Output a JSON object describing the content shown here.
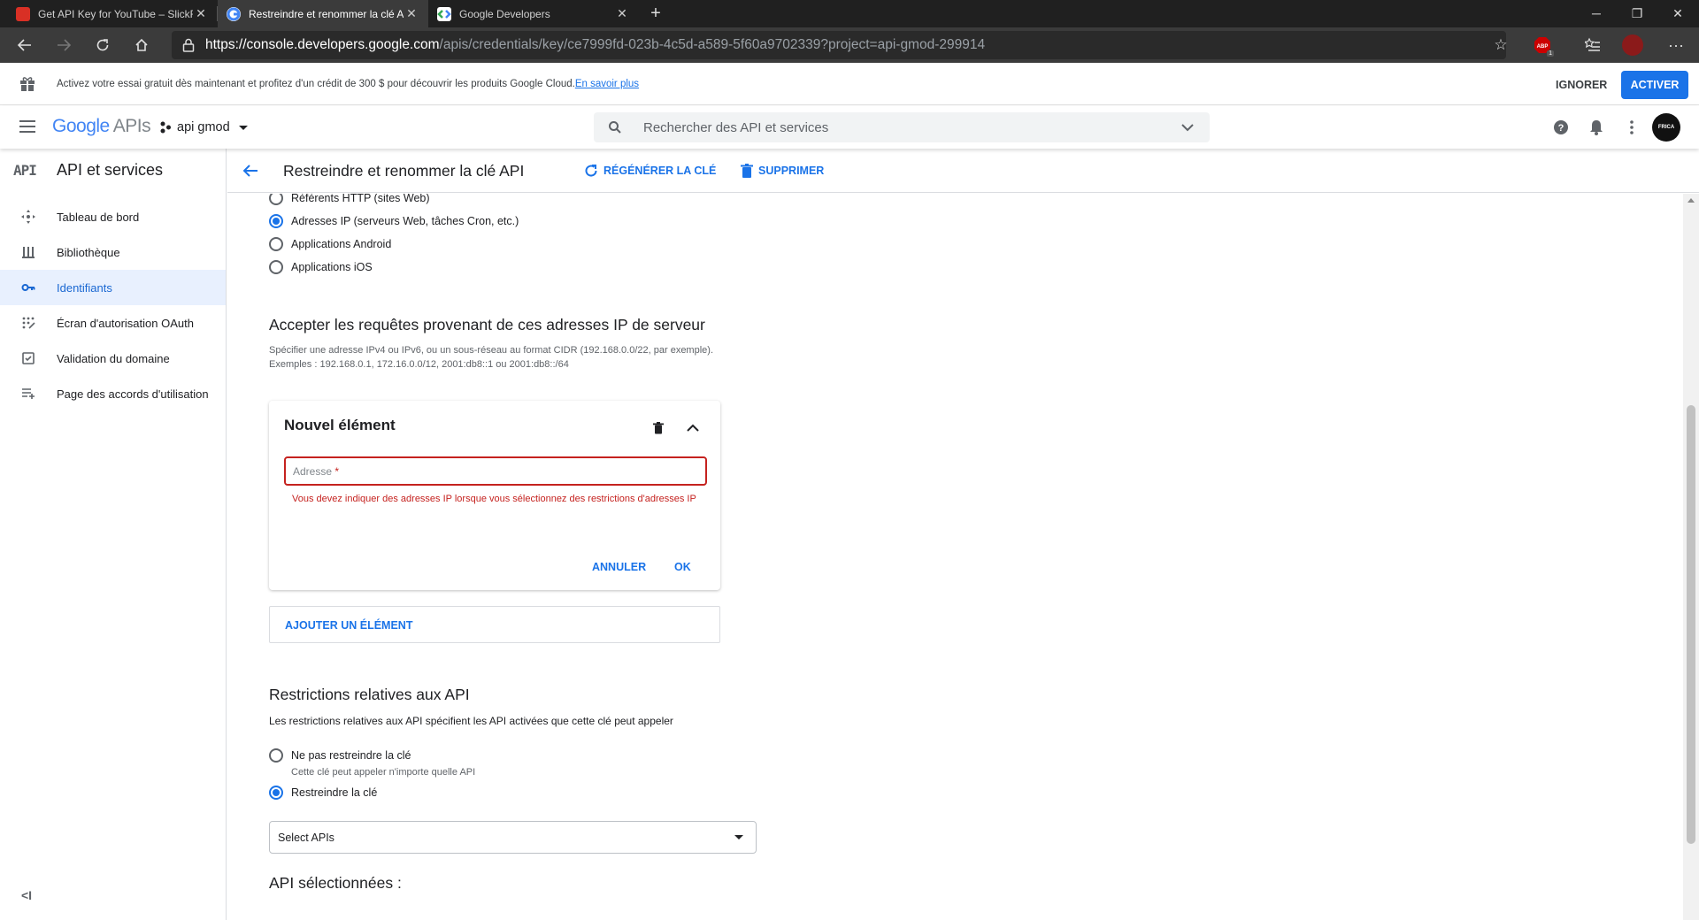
{
  "browser": {
    "tabs": [
      {
        "title": "Get API Key for YouTube – SlickR",
        "active": false,
        "favicon_color": "#d93025"
      },
      {
        "title": "Restreindre et renommer la clé A",
        "active": true,
        "favicon_color": "#ffffff"
      },
      {
        "title": "Google Developers",
        "active": false,
        "favicon_color": "#ffffff"
      }
    ],
    "url_host": "https://console.developers.google.com",
    "url_path": "/apis/credentials/key/ce7999fd-023b-4c5d-a589-5f60a9702339?project=api-gmod-299914",
    "abp_badge": "1"
  },
  "promo": {
    "text": "Activez votre essai gratuit dès maintenant et profitez d'un crédit de 300 $ pour découvrir les produits Google Cloud.",
    "link": "En savoir plus",
    "dismiss": "IGNORER",
    "activate": "ACTIVER"
  },
  "header": {
    "logo_google": "Google",
    "logo_apis": "APIs",
    "project": "api gmod",
    "search_placeholder": "Rechercher des API et services",
    "avatar_text": "FRICA"
  },
  "sidebar": {
    "title": "API et services",
    "items": [
      {
        "label": "Tableau de bord",
        "icon": "dashboard-icon",
        "active": false
      },
      {
        "label": "Bibliothèque",
        "icon": "library-icon",
        "active": false
      },
      {
        "label": "Identifiants",
        "icon": "key-icon",
        "active": true
      },
      {
        "label": "Écran d'autorisation OAuth",
        "icon": "oauth-icon",
        "active": false
      },
      {
        "label": "Validation du domaine",
        "icon": "domain-icon",
        "active": false
      },
      {
        "label": "Page des accords d'utilisation",
        "icon": "agreements-icon",
        "active": false
      }
    ]
  },
  "page": {
    "title": "Restreindre et renommer la clé API",
    "regenerate": "RÉGÉNÉRER LA CLÉ",
    "delete": "SUPPRIMER"
  },
  "app_restrictions": {
    "options": [
      {
        "label": "Référents HTTP (sites Web)",
        "checked": false
      },
      {
        "label": "Adresses IP (serveurs Web, tâches Cron, etc.)",
        "checked": true
      },
      {
        "label": "Applications Android",
        "checked": false
      },
      {
        "label": "Applications iOS",
        "checked": false
      }
    ]
  },
  "ip_section": {
    "heading": "Accepter les requêtes provenant de ces adresses IP de serveur",
    "help_line1": "Spécifier une adresse IPv4 ou IPv6, ou un sous-réseau au format CIDR (192.168.0.0/22, par exemple).",
    "help_line2": "Exemples : 192.168.0.1, 172.16.0.0/12, 2001:db8::1 ou 2001:db8::/64",
    "card_title": "Nouvel élément",
    "address_placeholder": "Adresse",
    "required_mark": "*",
    "error": "Vous devez indiquer des adresses IP lorsque vous sélectionnez des restrictions d'adresses IP",
    "cancel": "ANNULER",
    "ok": "OK",
    "add_item": "AJOUTER UN ÉLÉMENT"
  },
  "api_restrictions": {
    "heading": "Restrictions relatives aux API",
    "description": "Les restrictions relatives aux API spécifient les API activées que cette clé peut appeler",
    "options": [
      {
        "label": "Ne pas restreindre la clé",
        "sub": "Cette clé peut appeler n'importe quelle API",
        "checked": false
      },
      {
        "label": "Restreindre la clé",
        "sub": "",
        "checked": true
      }
    ],
    "select_value": "Select APIs",
    "selected_heading": "API sélectionnées :"
  }
}
